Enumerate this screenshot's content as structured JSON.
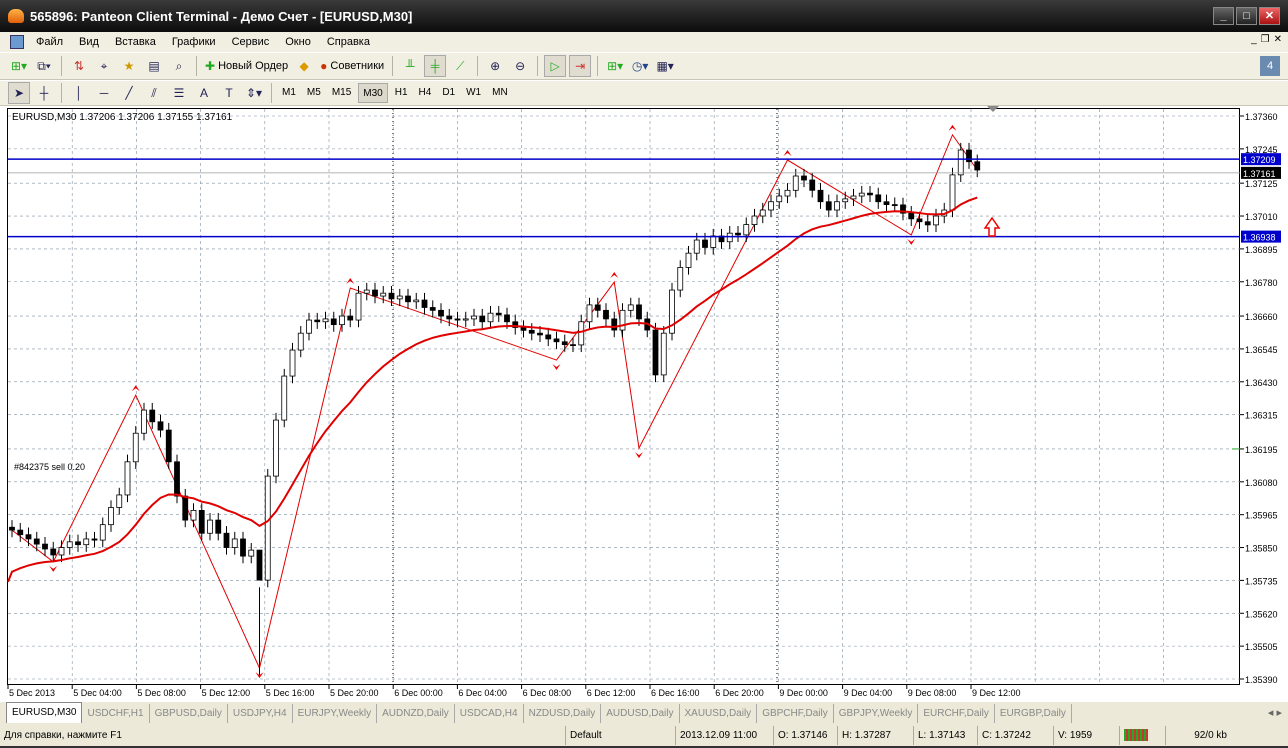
{
  "window": {
    "title": "565896: Panteon Client Terminal - Демо Счет - [EURUSD,M30]",
    "min": "_",
    "max": "□",
    "close": "✕"
  },
  "menu": [
    "Файл",
    "Вид",
    "Вставка",
    "Графики",
    "Сервис",
    "Окно",
    "Справка"
  ],
  "toolbar": {
    "new_order": "Новый Ордер",
    "advisors": "Советники"
  },
  "timeframes": [
    "M1",
    "M5",
    "M15",
    "M30",
    "H1",
    "H4",
    "D1",
    "W1",
    "MN"
  ],
  "active_timeframe": "M30",
  "chart": {
    "header": "EURUSD,M30  1.37206 1.37206 1.37155 1.37161",
    "order_label": "#842375 sell 0.20",
    "price_ticks": [
      "1.37360",
      "1.37245",
      "1.37125",
      "1.37010",
      "1.36895",
      "1.36780",
      "1.36660",
      "1.36545",
      "1.36430",
      "1.36315",
      "1.36195",
      "1.36080",
      "1.35965",
      "1.35850",
      "1.35735",
      "1.35620",
      "1.35505",
      "1.35390"
    ],
    "time_ticks": [
      "5 Dec 2013",
      "5 Dec 04:00",
      "5 Dec 08:00",
      "5 Dec 12:00",
      "5 Dec 16:00",
      "5 Dec 20:00",
      "6 Dec 00:00",
      "6 Dec 04:00",
      "6 Dec 08:00",
      "6 Dec 12:00",
      "6 Dec 16:00",
      "6 Dec 20:00",
      "9 Dec 00:00",
      "9 Dec 04:00",
      "9 Dec 08:00",
      "9 Dec 12:00"
    ],
    "hlines": [
      {
        "price": "1.37209",
        "color": "#0000cc"
      },
      {
        "price": "1.36938",
        "color": "#0000cc"
      }
    ],
    "bid": "1.37161",
    "colors": {
      "up": "#ffffff",
      "down": "#000000",
      "ma": "#e00000",
      "zigzag": "#e00000"
    }
  },
  "chart_data": {
    "type": "candlestick",
    "symbol": "EURUSD",
    "timeframe": "M30",
    "ylim": [
      1.3539,
      1.3736
    ],
    "closes": [
      1.35911,
      1.35895,
      1.3588,
      1.35862,
      1.35845,
      1.35824,
      1.3585,
      1.3587,
      1.3586,
      1.3588,
      1.35876,
      1.3593,
      1.3599,
      1.36034,
      1.3615,
      1.3625,
      1.36331,
      1.3629,
      1.36261,
      1.3615,
      1.3603,
      1.35946,
      1.3598,
      1.359,
      1.35946,
      1.359,
      1.3585,
      1.3588,
      1.3582,
      1.35841,
      1.35736,
      1.361,
      1.36296,
      1.3645,
      1.36541,
      1.366,
      1.36646,
      1.3664,
      1.3665,
      1.3663,
      1.3666,
      1.36646,
      1.3674,
      1.36751,
      1.3673,
      1.3674,
      1.3672,
      1.3673,
      1.3671,
      1.36716,
      1.3669,
      1.3668,
      1.3666,
      1.3665,
      1.36646,
      1.3665,
      1.3666,
      1.3664,
      1.3667,
      1.36664,
      1.3664,
      1.3662,
      1.3661,
      1.366,
      1.36594,
      1.3658,
      1.3657,
      1.3656,
      1.36559,
      1.3664,
      1.36699,
      1.3668,
      1.3665,
      1.36611,
      1.3668,
      1.36699,
      1.3665,
      1.36611,
      1.36454,
      1.366,
      1.36751,
      1.3683,
      1.3688,
      1.36926,
      1.369,
      1.3694,
      1.3692,
      1.3695,
      1.36944,
      1.3698,
      1.3701,
      1.37031,
      1.3706,
      1.3708,
      1.371,
      1.3715,
      1.37136,
      1.371,
      1.3706,
      1.37031,
      1.3706,
      1.3707,
      1.3708,
      1.3709,
      1.37084,
      1.3706,
      1.3705,
      1.37049,
      1.3702,
      1.37,
      1.3699,
      1.36979,
      1.3701,
      1.37031,
      1.37154,
      1.37241,
      1.372,
      1.37171
    ],
    "zigzag": [
      [
        0,
        1.35911
      ],
      [
        5,
        1.358
      ],
      [
        15,
        1.36383
      ],
      [
        30,
        1.35428
      ],
      [
        41,
        1.36758
      ],
      [
        66,
        1.36506
      ],
      [
        73,
        1.36779
      ],
      [
        76,
        1.36198
      ],
      [
        94,
        1.37206
      ],
      [
        109,
        1.36944
      ],
      [
        114,
        1.37294
      ],
      [
        117,
        1.37171
      ]
    ]
  },
  "tabs": [
    "EURUSD,M30",
    "USDCHF,H1",
    "GBPUSD,Daily",
    "USDJPY,H4",
    "EURJPY,Weekly",
    "AUDNZD,Daily",
    "USDCAD,H4",
    "NZDUSD,Daily",
    "AUDUSD,Daily",
    "XAUUSD,Daily",
    "GBPCHF,Daily",
    "GBPJPY,Weekly",
    "EURCHF,Daily",
    "EURGBP,Daily"
  ],
  "status": {
    "help": "Для справки, нажмите F1",
    "profile": "Default",
    "time": "2013.12.09 11:00",
    "open": "O: 1.37146",
    "high": "H: 1.37287",
    "low": "L: 1.37143",
    "close": "C: 1.37242",
    "volume": "V: 1959",
    "traffic": "92/0 kb"
  }
}
